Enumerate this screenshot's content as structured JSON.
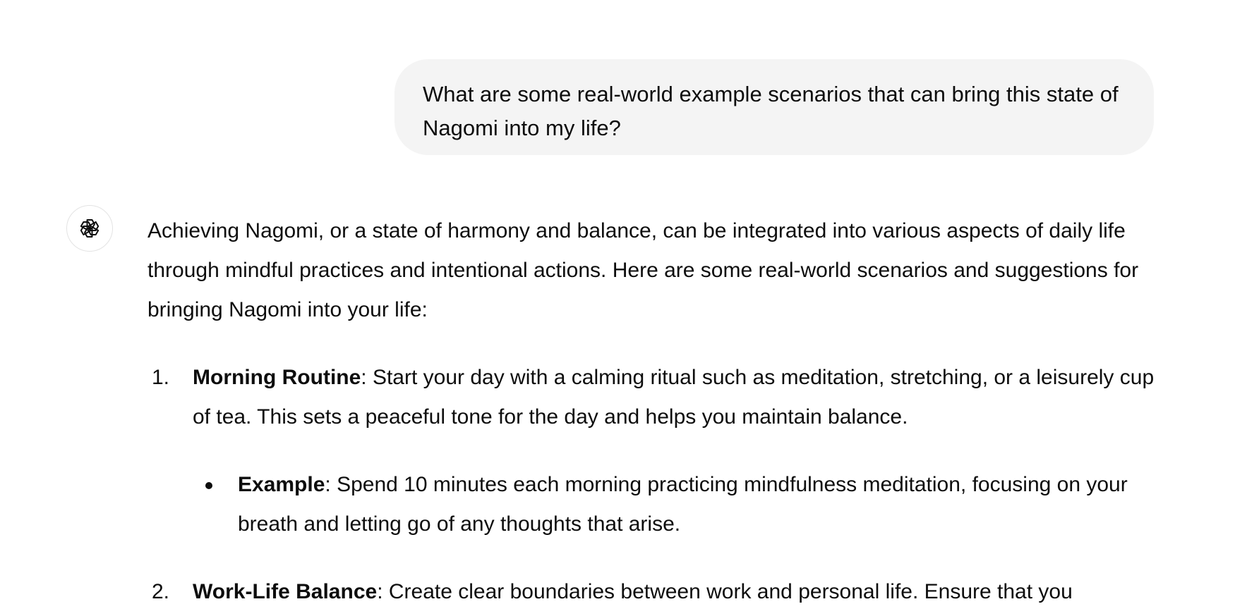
{
  "user_message": {
    "text": "What are some real-world example scenarios that can bring this state of Nagomi into my life?"
  },
  "assistant": {
    "avatar_icon": "openai-logo-icon",
    "intro": "Achieving Nagomi, or a state of harmony and balance, can be integrated into various aspects of daily life through mindful practices and intentional actions. Here are some real-world scenarios and suggestions for bringing Nagomi into your life:",
    "items": [
      {
        "number": "1.",
        "title": "Morning Routine",
        "body": ": Start your day with a calming ritual such as meditation, stretching, or a leisurely cup of tea. This sets a peaceful tone for the day and helps you maintain balance.",
        "sub": {
          "title": "Example",
          "body": ": Spend 10 minutes each morning practicing mindfulness meditation, focusing on your breath and letting go of any thoughts that arise."
        }
      },
      {
        "number": "2.",
        "title": "Work-Life Balance",
        "body": ": Create clear boundaries between work and personal life. Ensure that you"
      }
    ]
  }
}
